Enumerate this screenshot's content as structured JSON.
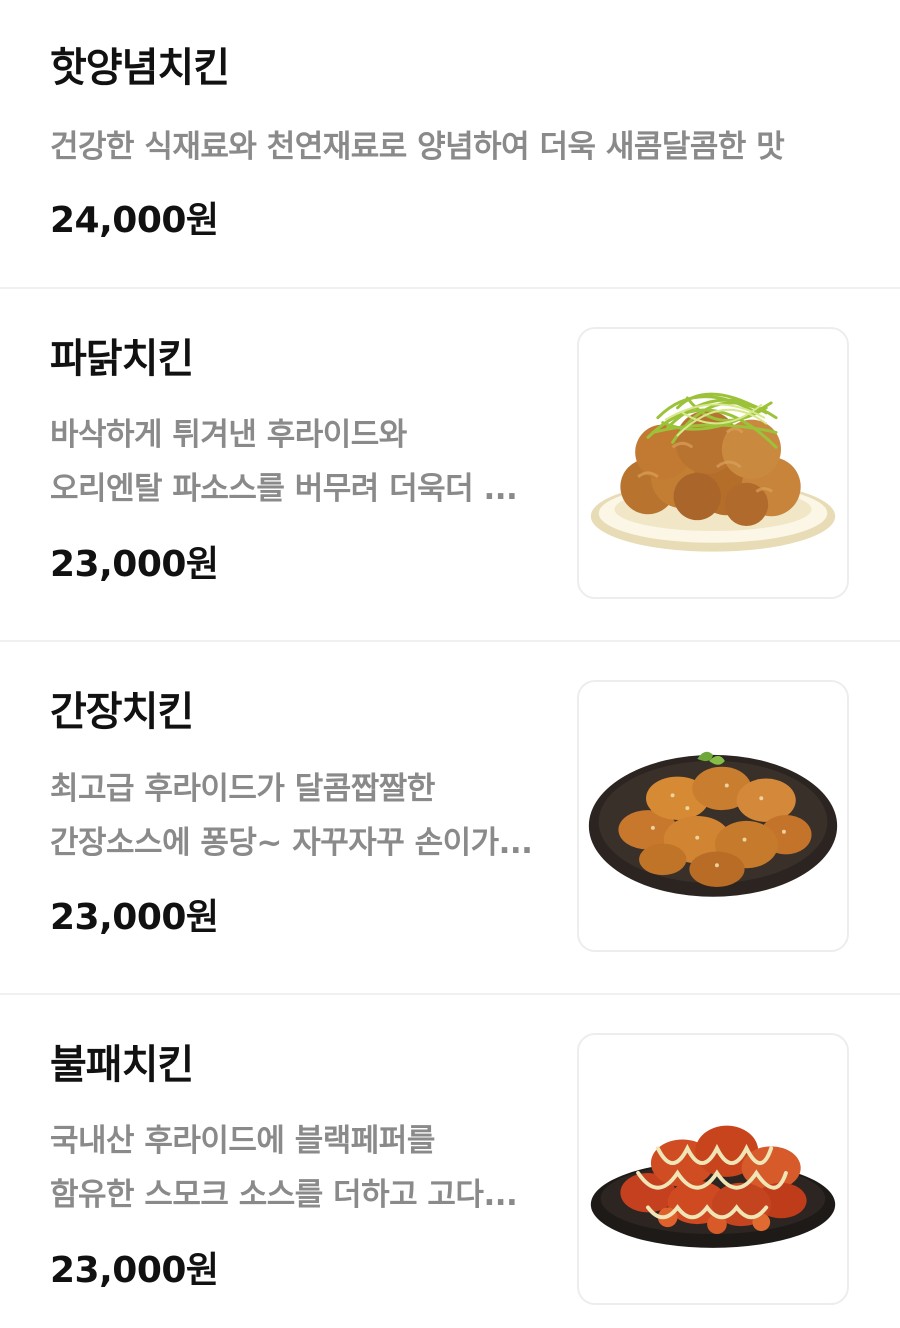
{
  "menu": {
    "items": [
      {
        "name": "핫양념치킨",
        "description": [
          "건강한 식재료와 천연재료로 양념하여 더욱 새콤달콤한 맛"
        ],
        "price": "24,000원",
        "has_image": false
      },
      {
        "name": "파닭치킨",
        "description": [
          "바삭하게 튀겨낸 후라이드와",
          "오리엔탈 파소스를 버무려 더욱더 ..."
        ],
        "price": "23,000원",
        "has_image": true
      },
      {
        "name": "간장치킨",
        "description": [
          "최고급 후라이드가 달콤짭짤한",
          "간장소스에 퐁당~ 자꾸자꾸 손이가..."
        ],
        "price": "23,000원",
        "has_image": true
      },
      {
        "name": "불패치킨",
        "description": [
          "국내산 후라이드에 블랙페퍼를",
          "함유한 스모크 소스를 더하고 고다..."
        ],
        "price": "23,000원",
        "has_image": true
      }
    ]
  },
  "colors": {
    "title_text": "#111111",
    "description_text": "#8a8a8a",
    "divider": "#f0f0f0",
    "thumbnail_border": "#ededed"
  }
}
